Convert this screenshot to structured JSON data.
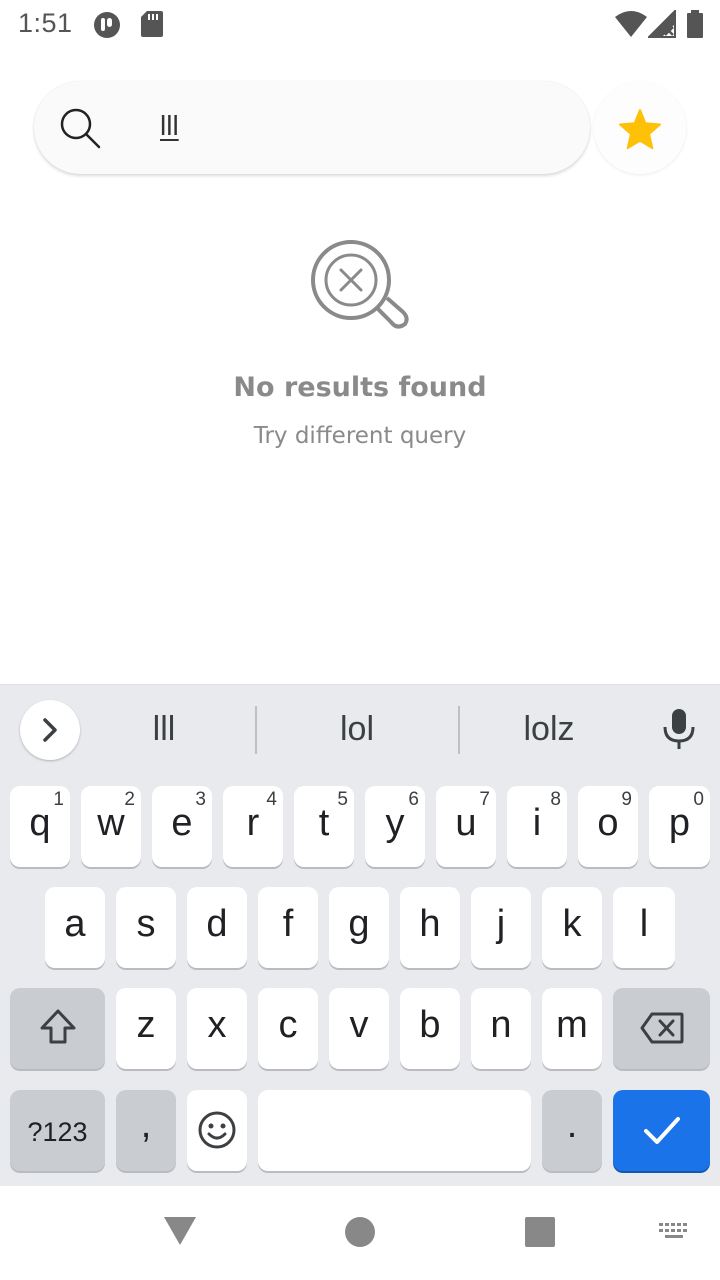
{
  "status_bar": {
    "time": "1:51",
    "icons": [
      "app-notification-icon",
      "sd-card-icon",
      "wifi-icon",
      "signal-icon",
      "battery-icon"
    ]
  },
  "search": {
    "query": "lll",
    "icon": "search-icon",
    "favorite_icon": "star-icon",
    "accent_color": "#FFC107"
  },
  "empty_state": {
    "icon": "no-results-magnifier-icon",
    "title": "No results found",
    "subtitle": "Try different query"
  },
  "keyboard": {
    "suggestions": [
      "lll",
      "lol",
      "lolz"
    ],
    "row1": [
      {
        "c": "q",
        "n": "1"
      },
      {
        "c": "w",
        "n": "2"
      },
      {
        "c": "e",
        "n": "3"
      },
      {
        "c": "r",
        "n": "4"
      },
      {
        "c": "t",
        "n": "5"
      },
      {
        "c": "y",
        "n": "6"
      },
      {
        "c": "u",
        "n": "7"
      },
      {
        "c": "i",
        "n": "8"
      },
      {
        "c": "o",
        "n": "9"
      },
      {
        "c": "p",
        "n": "0"
      }
    ],
    "row2": [
      "a",
      "s",
      "d",
      "f",
      "g",
      "h",
      "j",
      "k",
      "l"
    ],
    "row3": [
      "z",
      "x",
      "c",
      "v",
      "b",
      "n",
      "m"
    ],
    "symbols_label": "?123",
    "comma": ",",
    "period": ".",
    "enter_color": "#1A73E8"
  },
  "navbar": {
    "icons": [
      "back-icon",
      "home-icon",
      "recents-icon",
      "keyboard-switch-icon"
    ]
  }
}
